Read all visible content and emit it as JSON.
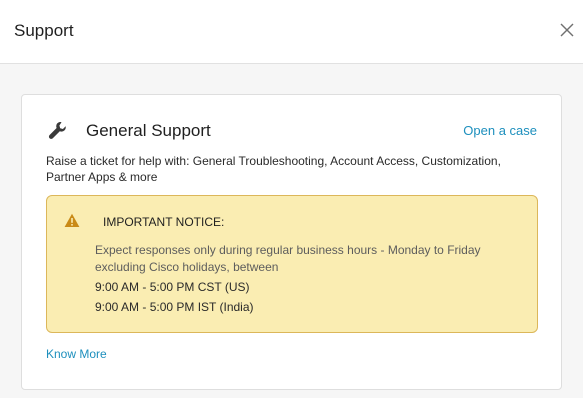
{
  "modal": {
    "title": "Support",
    "close_icon": "close-icon"
  },
  "card": {
    "icon": "wrench-icon",
    "title": "General Support",
    "action_link": "Open a case",
    "description": "Raise a ticket for help with: General Troubleshooting, Account Access, Customization, Partner Apps & more",
    "notice": {
      "icon": "warning-icon",
      "title": "IMPORTANT NOTICE:",
      "body": "Expect responses only during regular business hours - Monday to Friday excluding Cisco holidays, between",
      "hours": [
        "9:00 AM - 5:00 PM CST (US)",
        "9:00 AM - 5:00 PM IST (India)"
      ]
    },
    "know_more_link": "Know More"
  },
  "colors": {
    "link": "#1d8fbd",
    "notice_bg": "#faedb2",
    "notice_border": "#dcb75a",
    "warning_icon": "#c98a17"
  }
}
